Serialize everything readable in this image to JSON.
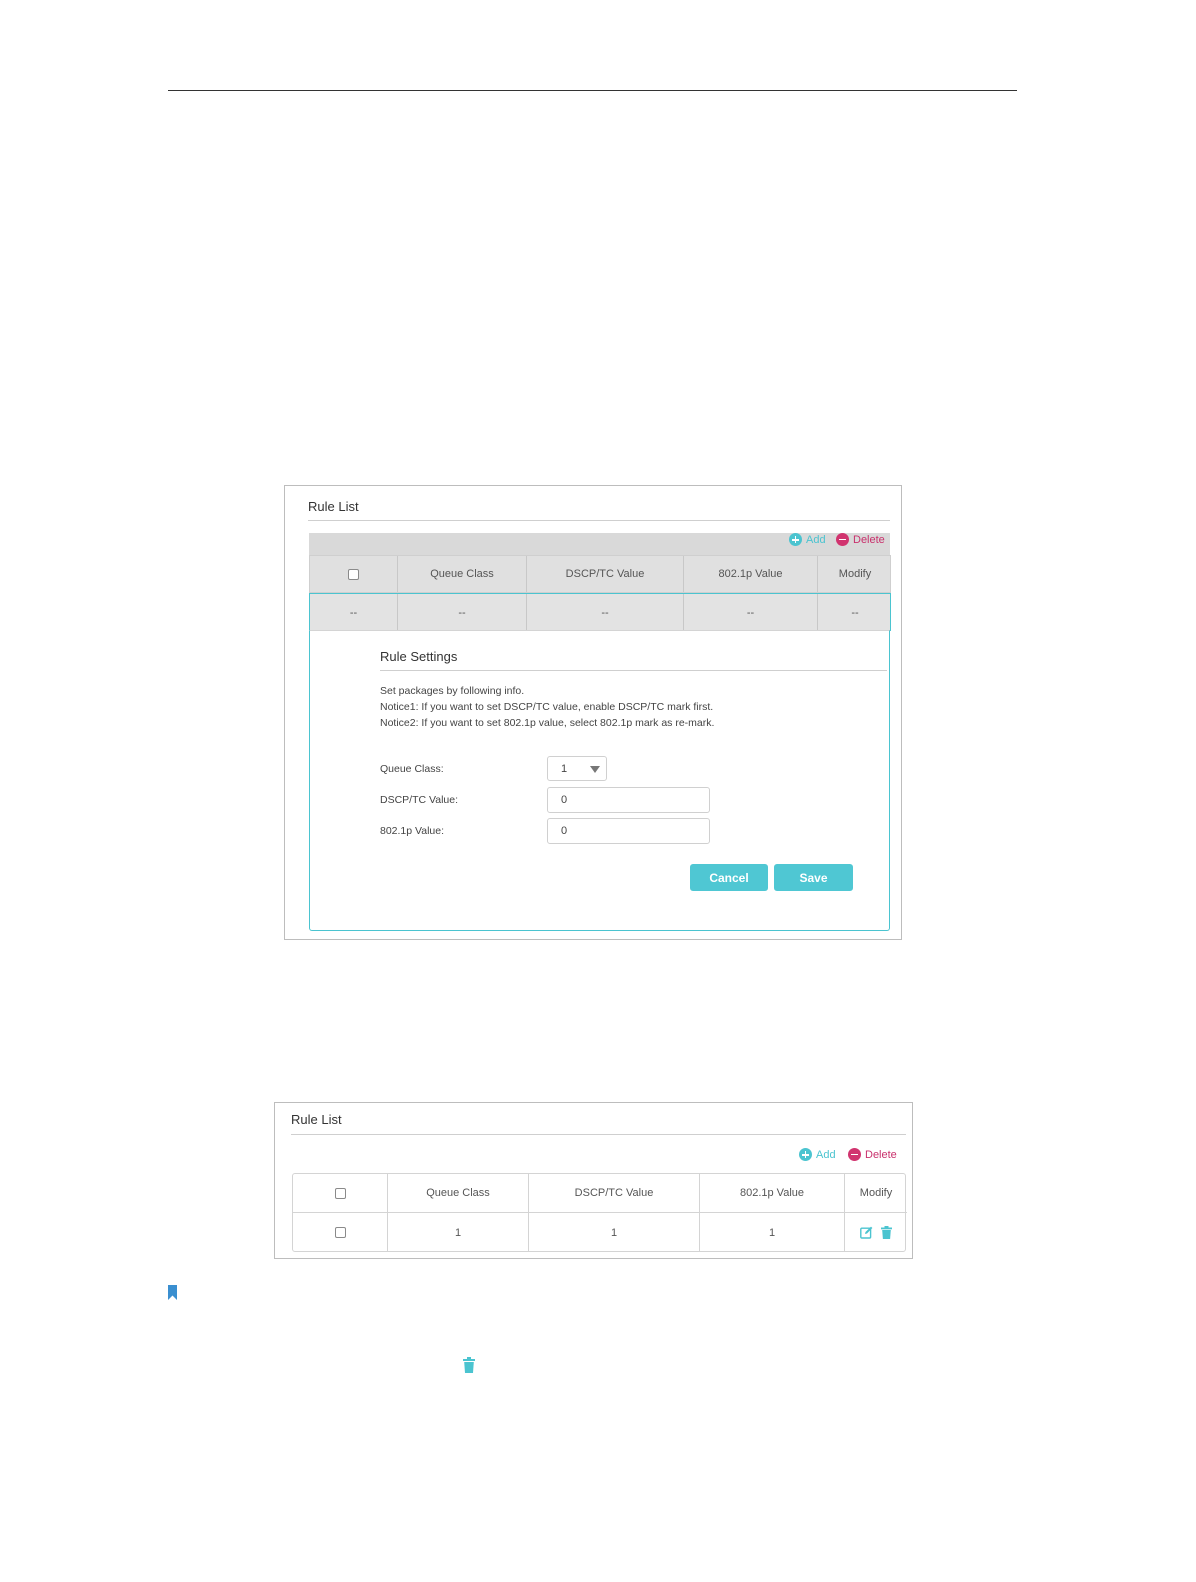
{
  "colors": {
    "accent": "#4bc4d0",
    "delete": "#d1346f",
    "button_bg": "#4fc7d3"
  },
  "panel1": {
    "title": "Rule List",
    "toolbar": {
      "add_label": "Add",
      "delete_label": "Delete"
    },
    "columns": [
      "Queue Class",
      "DSCP/TC Value",
      "802.1p Value",
      "Modify"
    ],
    "row": [
      "--",
      "--",
      "--",
      "--",
      "--"
    ],
    "settings": {
      "title": "Rule Settings",
      "notices": [
        "Set packages by following info.",
        "Notice1: If you want to set DSCP/TC value, enable DSCP/TC mark first.",
        "Notice2: If you want to set 802.1p value, select 802.1p mark as re-mark."
      ],
      "queue_class_label": "Queue Class:",
      "queue_class_value": "1",
      "dscp_label": "DSCP/TC Value:",
      "dscp_value": "0",
      "dot1p_label": "802.1p Value:",
      "dot1p_value": "0",
      "cancel_label": "Cancel",
      "save_label": "Save"
    }
  },
  "panel2": {
    "title": "Rule List",
    "toolbar": {
      "add_label": "Add",
      "delete_label": "Delete"
    },
    "columns": [
      "Queue Class",
      "DSCP/TC Value",
      "802.1p Value",
      "Modify"
    ],
    "row": {
      "queue_class": "1",
      "dscp": "1",
      "dot1p": "1"
    },
    "icons": {
      "edit": "edit-icon",
      "delete": "trash-icon"
    }
  },
  "page_icons": {
    "note": "bookmark-icon",
    "inline_delete": "trash-icon"
  }
}
